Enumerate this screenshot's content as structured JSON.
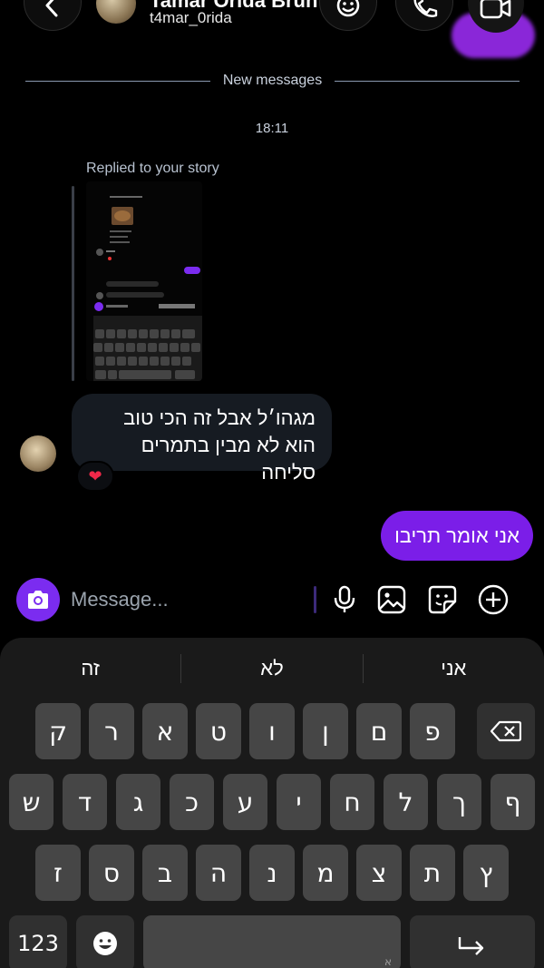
{
  "header": {
    "contact_name": "Tamar Orida Brun",
    "username": "t4mar_0rida",
    "icons": [
      "chevron-left-icon",
      "emoji-effects-icon",
      "phone-icon",
      "video-icon"
    ]
  },
  "thread": {
    "divider_label": "New messages",
    "timestamp": "18:11",
    "story_reply_label": "Replied to your story",
    "received": {
      "line1": "מגהו׳ל אבל זה הכי טוב",
      "line2": "הוא לא מבין בתמרים סליחה",
      "reaction": "❤"
    },
    "sent": {
      "text": "אני אומר תריבו"
    }
  },
  "composer": {
    "placeholder": "Message...",
    "icons": [
      "camera-icon",
      "microphone-icon",
      "gallery-icon",
      "sticker-icon",
      "plus-circle-icon"
    ]
  },
  "keyboard": {
    "suggestions": [
      "זה",
      "לא",
      "אני"
    ],
    "row1": [
      "ק",
      "ר",
      "א",
      "ט",
      "ו",
      "ן",
      "ם",
      "פ"
    ],
    "row2": [
      "ש",
      "ד",
      "ג",
      "כ",
      "ע",
      "י",
      "ח",
      "ל",
      "ך",
      "ף"
    ],
    "row3": [
      "ז",
      "ס",
      "ב",
      "ה",
      "נ",
      "מ",
      "צ",
      "ת",
      "ץ"
    ],
    "numbers_key": "123",
    "space_hint": "א"
  },
  "colors": {
    "accent": "#7b1ee8",
    "camera_button": "#7b2cf0",
    "bubble_received": "#161b22",
    "keyboard_bg": "#1a1a1a",
    "key_bg": "#464646"
  }
}
